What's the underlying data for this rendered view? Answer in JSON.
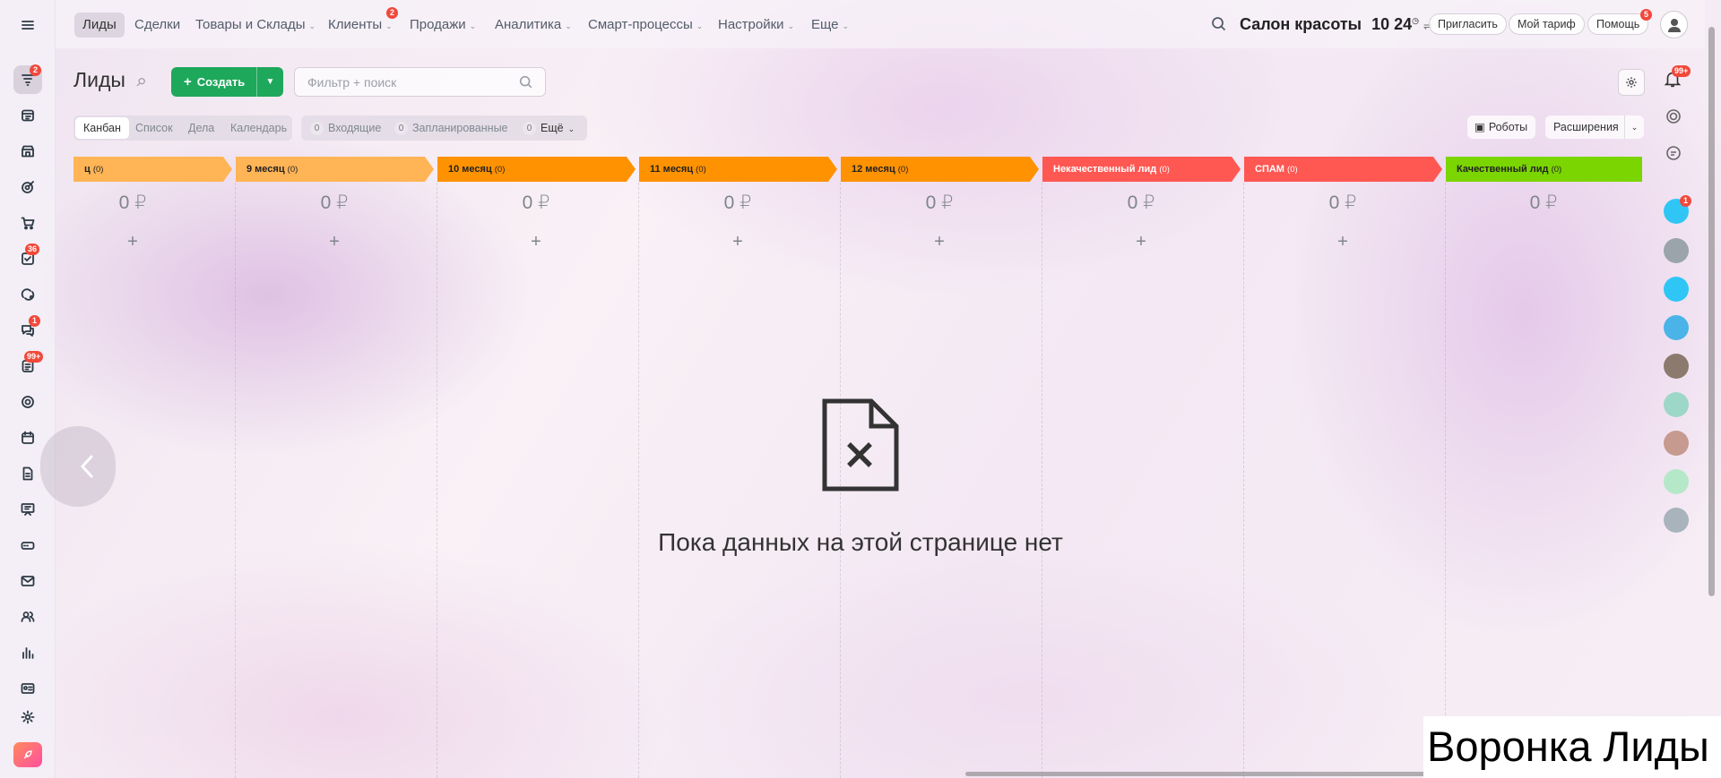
{
  "nav": {
    "items": [
      {
        "label": "Лиды",
        "chevron": false
      },
      {
        "label": "Сделки",
        "chevron": false
      },
      {
        "label": "Товары и Склады",
        "chevron": true
      },
      {
        "label": "Клиенты",
        "chevron": true,
        "badge": "2"
      },
      {
        "label": "Продажи",
        "chevron": true
      },
      {
        "label": "Аналитика",
        "chevron": true
      },
      {
        "label": "Смарт-процессы",
        "chevron": true
      },
      {
        "label": "Настройки",
        "chevron": true
      },
      {
        "label": "Еще",
        "chevron": true
      }
    ],
    "company": "Салон красоты",
    "time": "10 24",
    "invite": "Пригласить",
    "tariff": "Мой тариф",
    "help": "Помощь",
    "help_badge": "5"
  },
  "rail_badges": {
    "leads": "2",
    "tasks": "36",
    "chat": "1",
    "feed": "99+"
  },
  "right_badges": {
    "notifications": "99+",
    "chat": "1"
  },
  "toolbar": {
    "title": "Лиды",
    "create": "Создать",
    "search_placeholder": "Фильтр + поиск",
    "robots": "Роботы",
    "extensions": "Расширения"
  },
  "views": [
    "Канбан",
    "Список",
    "Дела",
    "Календарь"
  ],
  "counters": {
    "incoming": {
      "count": "0",
      "label": "Входящие"
    },
    "planned": {
      "count": "0",
      "label": "Запланированные"
    },
    "more": {
      "count": "0",
      "label": "Ещё"
    }
  },
  "stages": [
    {
      "name": "ц",
      "count": "(0)",
      "sum": "0 ₽",
      "color": "#ffb456"
    },
    {
      "name": "9 месяц",
      "count": "(0)",
      "sum": "0 ₽",
      "color": "#ffb456"
    },
    {
      "name": "10 месяц",
      "count": "(0)",
      "sum": "0 ₽",
      "color": "#ff9200"
    },
    {
      "name": "11 месяц",
      "count": "(0)",
      "sum": "0 ₽",
      "color": "#ff9200"
    },
    {
      "name": "12 месяц",
      "count": "(0)",
      "sum": "0 ₽",
      "color": "#ff9200"
    },
    {
      "name": "Некачественный лид",
      "count": "(0)",
      "sum": "0 ₽",
      "color": "#ff5752"
    },
    {
      "name": "СПАМ",
      "count": "(0)",
      "sum": "0 ₽",
      "color": "#ff5752"
    },
    {
      "name": "Качественный лид",
      "count": "(0)",
      "sum": "0 ₽",
      "color": "#7bd500"
    }
  ],
  "add_symbol": "+",
  "empty_message": "Пока данных на этой странице нет",
  "watermark": "Воронка Лиды"
}
